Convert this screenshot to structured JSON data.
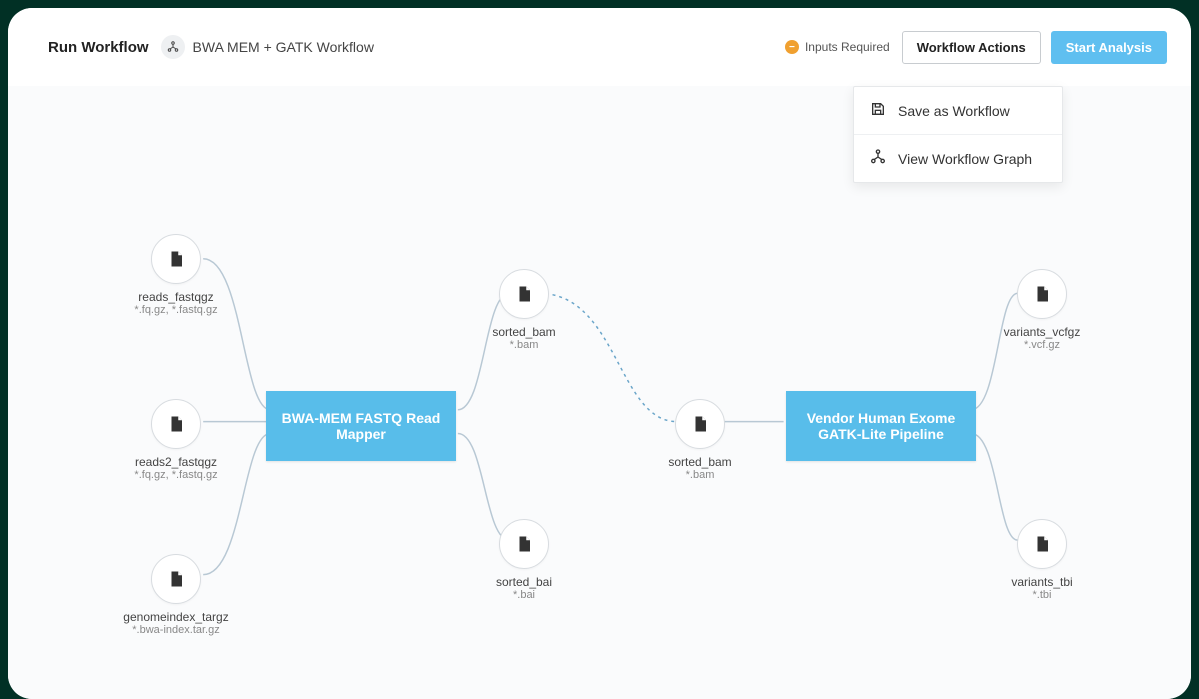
{
  "header": {
    "title": "Run Workflow",
    "workflow_name": "BWA MEM + GATK Workflow",
    "status_label": "Inputs Required",
    "actions_label": "Workflow Actions",
    "start_label": "Start Analysis"
  },
  "dropdown": {
    "save_label": "Save as Workflow",
    "view_label": "View Workflow Graph"
  },
  "nodes": {
    "reads_fastqgz": {
      "label": "reads_fastqgz",
      "ext": "*.fq.gz, *.fastq.gz"
    },
    "reads2_fastqgz": {
      "label": "reads2_fastqgz",
      "ext": "*.fq.gz, *.fastq.gz"
    },
    "genomeindex_targz": {
      "label": "genomeindex_targz",
      "ext": "*.bwa-index.tar.gz"
    },
    "sorted_bam_out": {
      "label": "sorted_bam",
      "ext": "*.bam"
    },
    "sorted_bai": {
      "label": "sorted_bai",
      "ext": "*.bai"
    },
    "sorted_bam_in": {
      "label": "sorted_bam",
      "ext": "*.bam"
    },
    "variants_vcfgz": {
      "label": "variants_vcfgz",
      "ext": "*.vcf.gz"
    },
    "variants_tbi": {
      "label": "variants_tbi",
      "ext": "*.tbi"
    },
    "proc1": {
      "label": "BWA-MEM FASTQ Read Mapper"
    },
    "proc2": {
      "label": "Vendor Human Exome GATK-Lite Pipeline"
    }
  }
}
